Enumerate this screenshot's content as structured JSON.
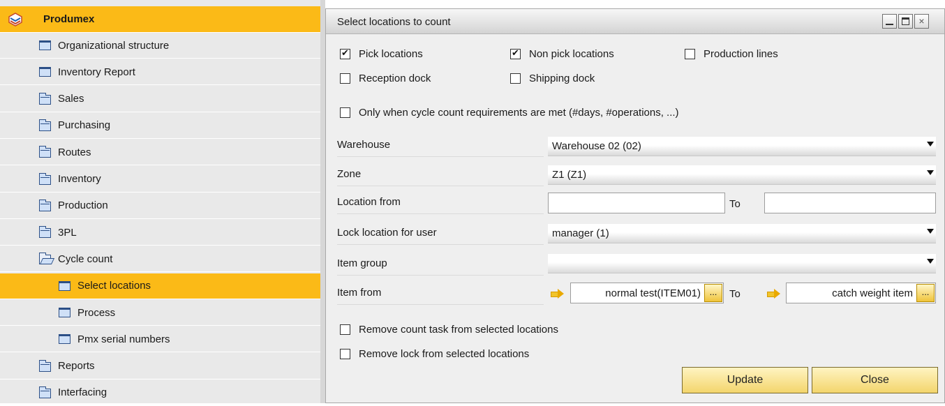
{
  "nav": {
    "root_label": "Produmex",
    "items": [
      {
        "label": "Organizational structure",
        "icon": "window-icon"
      },
      {
        "label": "Inventory Report",
        "icon": "window-icon"
      },
      {
        "label": "Sales",
        "icon": "folder-icon"
      },
      {
        "label": "Purchasing",
        "icon": "folder-icon"
      },
      {
        "label": "Routes",
        "icon": "folder-icon"
      },
      {
        "label": "Inventory",
        "icon": "folder-icon"
      },
      {
        "label": "Production",
        "icon": "folder-icon"
      },
      {
        "label": "3PL",
        "icon": "folder-icon"
      },
      {
        "label": "Cycle count",
        "icon": "open-folder-icon"
      },
      {
        "label": "Select locations",
        "icon": "window-icon",
        "selected": true
      },
      {
        "label": "Process",
        "icon": "window-icon"
      },
      {
        "label": "Pmx serial numbers",
        "icon": "window-icon"
      },
      {
        "label": "Reports",
        "icon": "folder-icon"
      },
      {
        "label": "Interfacing",
        "icon": "folder-icon"
      }
    ]
  },
  "dialog": {
    "title": "Select locations to count",
    "close_glyph": "×",
    "checkboxes": {
      "pick_locations": {
        "label": "Pick locations",
        "checked": true
      },
      "non_pick_locations": {
        "label": "Non pick locations",
        "checked": true
      },
      "production_lines": {
        "label": "Production lines",
        "checked": false
      },
      "reception_dock": {
        "label": "Reception dock",
        "checked": false
      },
      "shipping_dock": {
        "label": "Shipping dock",
        "checked": false
      },
      "only_cycle_count": {
        "label": "Only when cycle count requirements are met (#days, #operations, ...)",
        "checked": false
      },
      "remove_count_task": {
        "label": "Remove count task from selected locations",
        "checked": false
      },
      "remove_lock": {
        "label": "Remove lock from selected locations",
        "checked": false
      }
    },
    "fields": {
      "warehouse": {
        "label": "Warehouse",
        "value": "Warehouse 02 (02)"
      },
      "zone": {
        "label": "Zone",
        "value": "Z1 (Z1)"
      },
      "location_from": {
        "label": "Location from",
        "value": "",
        "to_label": "To",
        "to_value": ""
      },
      "lock_user": {
        "label": "Lock location for user",
        "value": "manager (1)"
      },
      "item_group": {
        "label": "Item group",
        "value": ""
      },
      "item_from": {
        "label": "Item from",
        "value": "normal test(ITEM01)",
        "to_label": "To",
        "to_value": "catch weight item",
        "dots": "..."
      }
    },
    "buttons": {
      "update": "Update",
      "close": "Close"
    }
  },
  "colors": {
    "accent": "#fbba17",
    "nav_bg": "#e9e9e9",
    "dialog_bg": "#efefef"
  }
}
